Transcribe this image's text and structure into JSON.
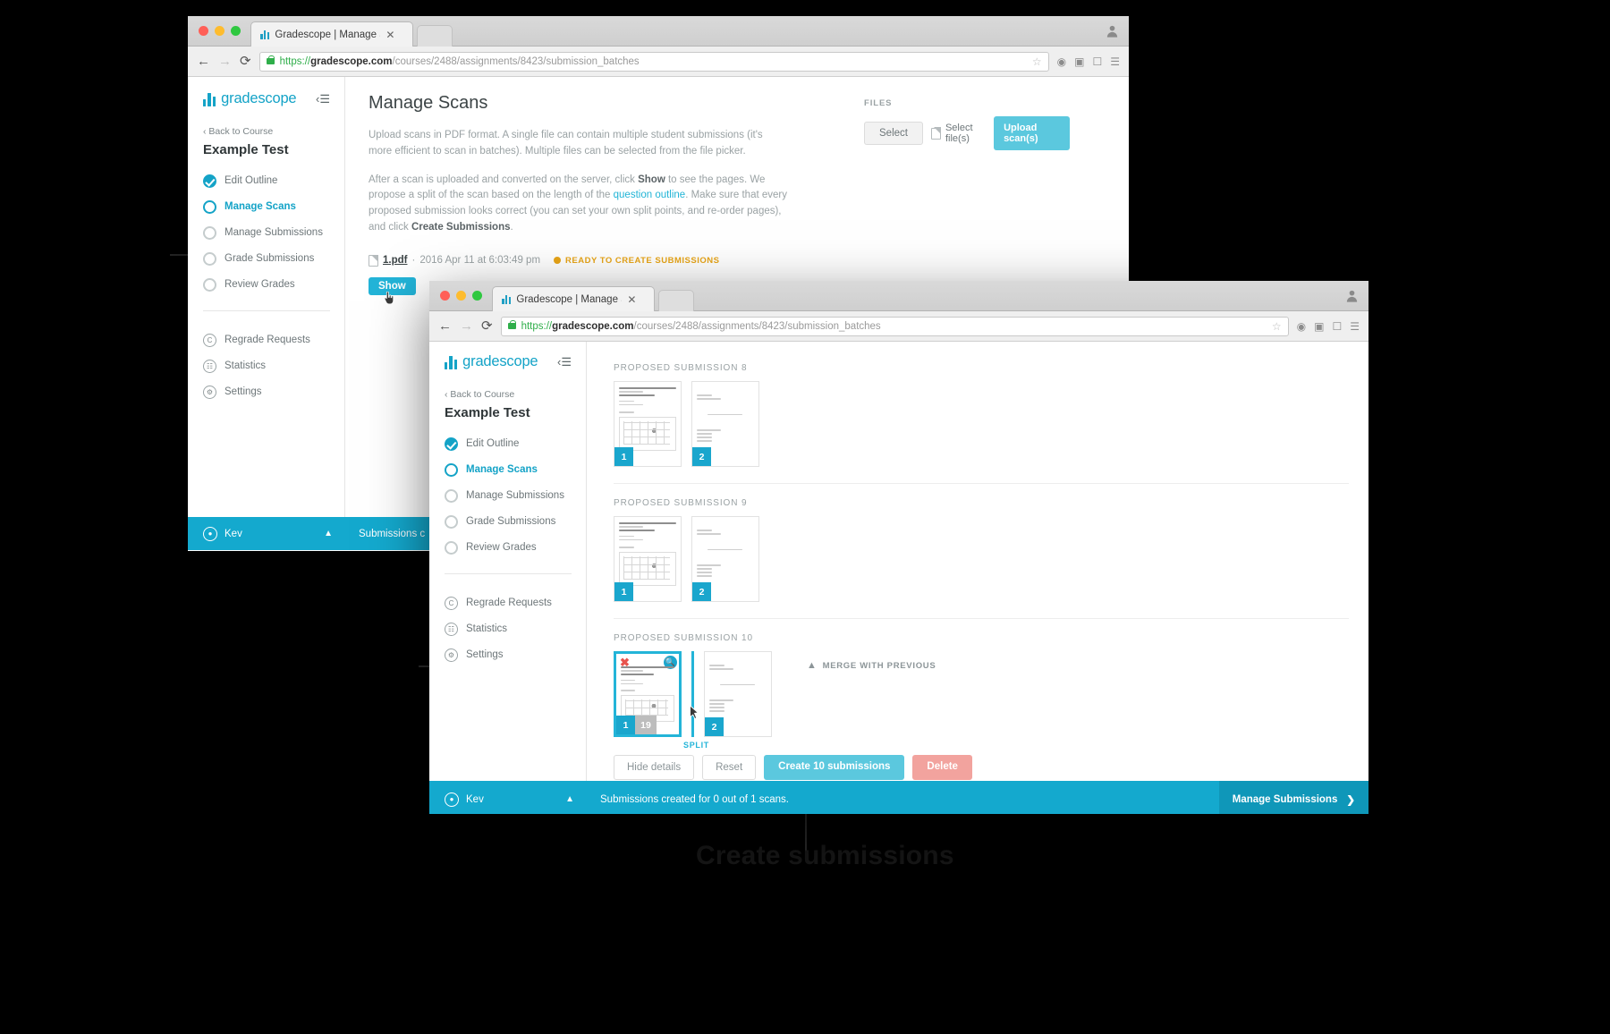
{
  "window1": {
    "tab_title": "Gradescope | Manage Scan",
    "url_scheme": "https://",
    "url_host": "gradescope.com",
    "url_path": "/courses/2488/assignments/8423/submission_batches",
    "sidebar": {
      "brand": "gradescope",
      "back_link": "Back to Course",
      "course": "Example Test",
      "items": [
        {
          "label": "Edit Outline",
          "state": "done"
        },
        {
          "label": "Manage Scans",
          "state": "active"
        },
        {
          "label": "Manage Submissions",
          "state": "todo"
        },
        {
          "label": "Grade Submissions",
          "state": "todo"
        },
        {
          "label": "Review Grades",
          "state": "todo"
        }
      ],
      "tools": [
        {
          "label": "Regrade Requests",
          "icon": "C"
        },
        {
          "label": "Statistics",
          "icon": "bars"
        },
        {
          "label": "Settings",
          "icon": "gear"
        }
      ]
    },
    "page_title": "Manage Scans",
    "para1": "Upload scans in PDF format. A single file can contain multiple student submissions (it's more efficient to scan in batches). Multiple files can be selected from the file picker.",
    "para2_a": "After a scan is uploaded and converted on the server, click ",
    "para2_b": "Show",
    "para2_c": " to see the pages. We propose a split of the scan based on the length of the ",
    "para2_link": "question outline",
    "para2_d": ". Make sure that every proposed submission looks correct (you can set your own split points, and re-order pages), and click ",
    "para2_e": "Create Submissions",
    "para2_f": ".",
    "file": {
      "name": "1.pdf",
      "sep": "·",
      "timestamp": "2016 Apr 11 at 6:03:49 pm",
      "status": "READY TO CREATE SUBMISSIONS"
    },
    "show_button": "Show",
    "files_panel": {
      "label": "FILES",
      "select_button": "Select",
      "select_files_text": "Select file(s)",
      "upload_button": "Upload scan(s)"
    },
    "statusbar": {
      "user": "Kev",
      "message": "Submissions c"
    }
  },
  "window2": {
    "tab_title": "Gradescope | Manage Scan",
    "url_scheme": "https://",
    "url_host": "gradescope.com",
    "url_path": "/courses/2488/assignments/8423/submission_batches",
    "sidebar": {
      "brand": "gradescope",
      "back_link": "Back to Course",
      "course": "Example Test",
      "items": [
        {
          "label": "Edit Outline",
          "state": "done"
        },
        {
          "label": "Manage Scans",
          "state": "active"
        },
        {
          "label": "Manage Submissions",
          "state": "todo"
        },
        {
          "label": "Grade Submissions",
          "state": "todo"
        },
        {
          "label": "Review Grades",
          "state": "todo"
        }
      ],
      "tools": [
        {
          "label": "Regrade Requests",
          "icon": "C"
        },
        {
          "label": "Statistics",
          "icon": "bars"
        },
        {
          "label": "Settings",
          "icon": "gear"
        }
      ]
    },
    "submissions": [
      {
        "heading": "PROPOSED SUBMISSION 8",
        "pages": [
          {
            "num": "1"
          },
          {
            "num": "2"
          }
        ]
      },
      {
        "heading": "PROPOSED SUBMISSION 9",
        "pages": [
          {
            "num": "1"
          },
          {
            "num": "2"
          }
        ]
      },
      {
        "heading": "PROPOSED SUBMISSION 10",
        "pages": [
          {
            "num": "1",
            "count": "19",
            "selected": true
          },
          {
            "num": "2"
          }
        ],
        "split_label": "SPLIT",
        "merge_label": "MERGE WITH PREVIOUS"
      }
    ],
    "actions": {
      "hide_details": "Hide details",
      "reset": "Reset",
      "create": "Create 10 submissions",
      "delete": "Delete"
    },
    "statusbar": {
      "user": "Kev",
      "message": "Submissions created for 0 out of 1 scans.",
      "cta": "Manage Submissions"
    }
  },
  "annotations": {
    "a1": "",
    "a2": "",
    "a3": "",
    "a4": "",
    "bottom": "Create submissions"
  }
}
